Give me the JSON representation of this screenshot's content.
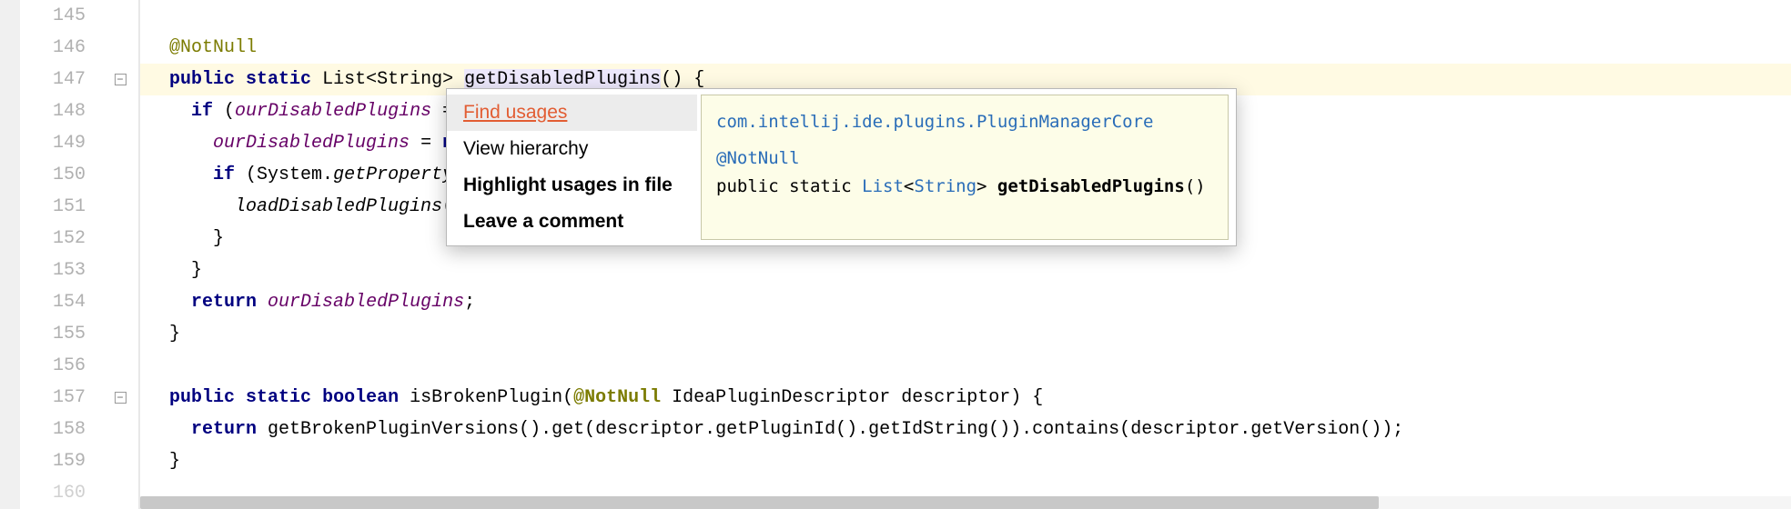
{
  "gutter": {
    "start": 145,
    "end": 160
  },
  "fold_lines": [
    147,
    157
  ],
  "code": {
    "l145": "",
    "l146_ann": "@NotNull",
    "l147_public": "public",
    "l147_static": "static",
    "l147_list": "List",
    "l147_string": "String",
    "l147_method": "getDisabledPlugins",
    "l147_rest": "() {",
    "l148_if": "if",
    "l148_open": " (",
    "l148_field": "ourDisabledPlugins",
    "l148_op": " ==",
    "l149_field": "ourDisabledPlugins",
    "l149_eq": " = ",
    "l149_new": "ne",
    "l150_if": "if",
    "l150_open": " (System.",
    "l150_call": "getProperty",
    "l150_paren": "(",
    "l151_call": "loadDisabledPlugins",
    "l151_rest": "(P",
    "l152_close": "}",
    "l153_close": "}",
    "l154_return": "return",
    "l154_field": "ourDisabledPlugins",
    "l154_semi": ";",
    "l155_close": "}",
    "l156": "",
    "l157_public": "public",
    "l157_static": "static",
    "l157_boolean": "boolean",
    "l157_method": "isBrokenPlugin",
    "l157_open": "(",
    "l157_ann": "@NotNull",
    "l157_rest": " IdeaPluginDescriptor descriptor) {",
    "l158_return": "return",
    "l158_call": " getBrokenPluginVersions().get(descriptor.getPluginId().getIdString()).contains(descriptor.getVersion());",
    "l159_close": "}"
  },
  "popup": {
    "menu": [
      {
        "label": "Find usages",
        "selected": true
      },
      {
        "label": "View hierarchy",
        "selected": false
      },
      {
        "label": "Highlight usages in file",
        "selected": false
      },
      {
        "label": "Leave a comment",
        "selected": false
      }
    ],
    "doc": {
      "fqcn": "com.intellij.ide.plugins.PluginManagerCore",
      "ann": "@NotNull",
      "sig_prefix": "public static ",
      "sig_type1": "List",
      "sig_lt": "<",
      "sig_type2": "String",
      "sig_gt": "> ",
      "sig_method": "getDisabledPlugins",
      "sig_suffix": "()"
    }
  }
}
